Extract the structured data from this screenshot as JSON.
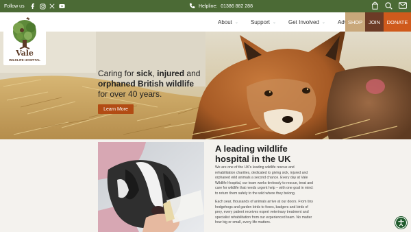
{
  "topbar": {
    "follow_label": "Follow us",
    "social_icons": [
      "facebook-icon",
      "instagram-icon",
      "x-icon",
      "youtube-icon"
    ],
    "helpline_label": "Helpline:",
    "helpline_number": "01386 882 288",
    "action_icons": [
      "bag-icon",
      "search-icon",
      "mail-icon"
    ]
  },
  "logo": {
    "name": "Vale",
    "subtitle": "WILDLIFE HOSPITAL"
  },
  "nav": {
    "items": [
      {
        "label": "About"
      },
      {
        "label": "Support"
      },
      {
        "label": "Get Involved"
      },
      {
        "label": "Advice"
      }
    ],
    "shop": "SHOP",
    "join": "JOIN",
    "donate": "DONATE"
  },
  "hero": {
    "line1_a": "Caring for ",
    "line1_b": "sick",
    "line1_c": ", ",
    "line1_d": "injured",
    "line1_e": " and",
    "line2": "orphaned British wildlife",
    "line3": "for over 40 years.",
    "button": "Learn More"
  },
  "intro": {
    "heading": "A leading wildlife hospital in the UK",
    "para1": "We are one of the UK's leading wildlife rescue and rehabilitation charities, dedicated to giving sick, injured and orphaned wild animals a second chance. Every day at Vale Wildlife Hospital, our team works tirelessly to rescue, treat and care for wildlife that needs urgent help – with one goal in mind: to return them safely to the wild where they belong.",
    "para2": "Each year, thousands of animals arrive at our doors. From tiny hedgehogs and garden birds to foxes, badgers and birds of prey, every patient receives expert veterinary treatment and specialist rehabilitation from our experienced team. No matter how big or small, every life matters."
  },
  "colors": {
    "topbar": "#4b6a35",
    "shop": "#c9a87b",
    "join": "#6c3b26",
    "donate": "#cf5a1c",
    "hero_button": "#b24c14"
  }
}
